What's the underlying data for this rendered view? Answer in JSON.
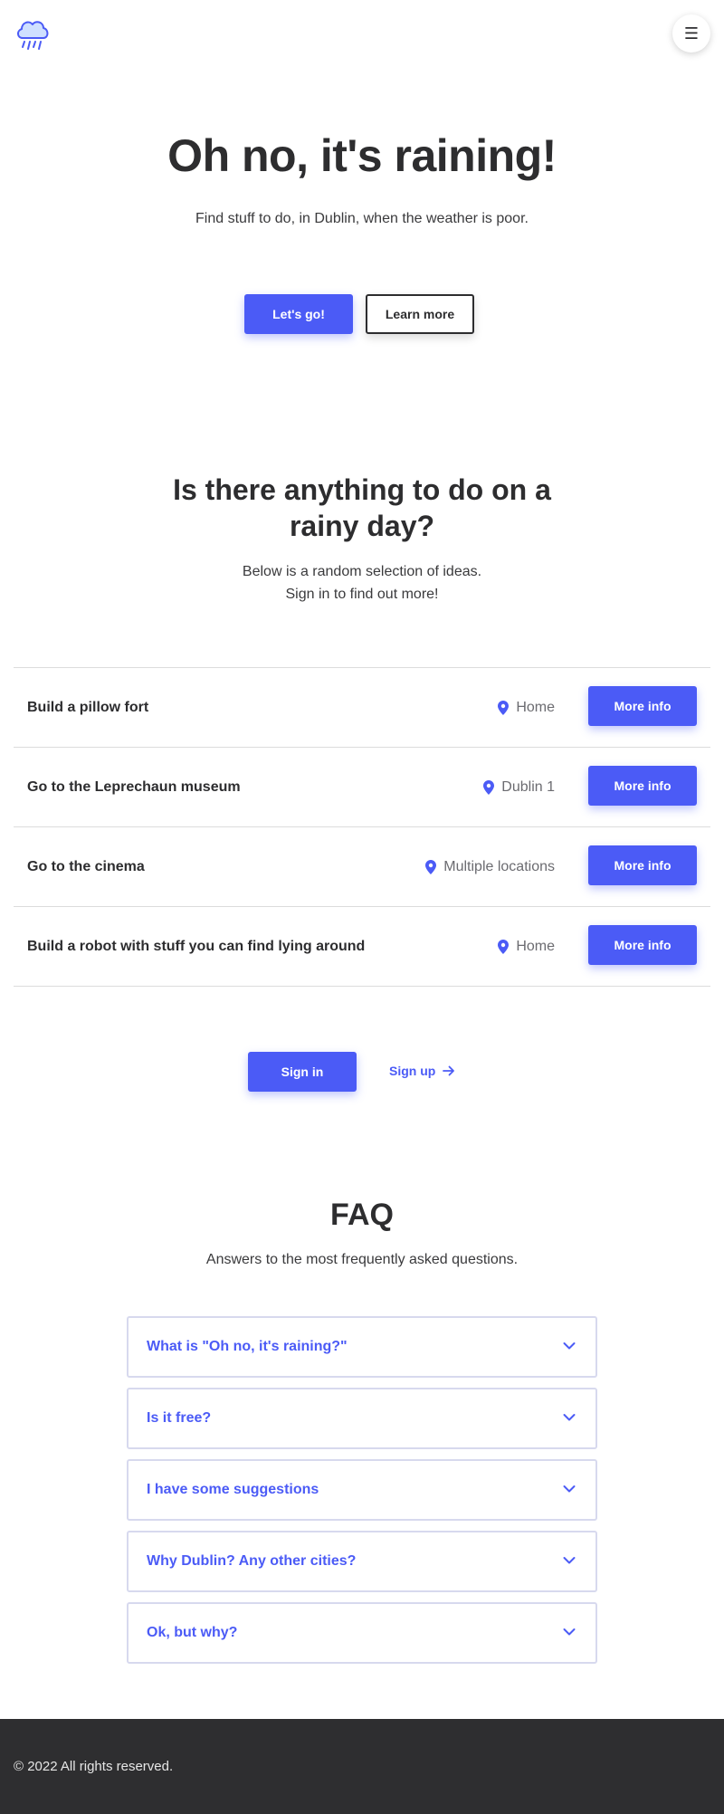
{
  "header": {
    "logo_icon": "rain-cloud-icon",
    "menu_icon": "hamburger-icon",
    "menu_glyph": "☰"
  },
  "hero": {
    "title": "Oh no, it's raining!",
    "subtitle": "Find stuff to do, in Dublin, when the weather is poor.",
    "primary_button": "Let's go!",
    "secondary_button": "Learn more"
  },
  "ideas": {
    "title": "Is there anything to do on a rainy day?",
    "subtitle_line1": "Below is a random selection of ideas.",
    "subtitle_line2": "Sign in to find out more!",
    "items": [
      {
        "title": "Build a pillow fort",
        "location": "Home",
        "button": "More info"
      },
      {
        "title": "Go to the Leprechaun museum",
        "location": "Dublin 1",
        "button": "More info"
      },
      {
        "title": "Go to the cinema",
        "location": "Multiple locations",
        "button": "More info"
      },
      {
        "title": "Build a robot with stuff you can find lying around",
        "location": "Home",
        "button": "More info"
      }
    ],
    "sign_in": "Sign in",
    "sign_up": "Sign up"
  },
  "faq": {
    "title": "FAQ",
    "subtitle": "Answers to the most frequently asked questions.",
    "items": [
      {
        "question": "What is \"Oh no, it's raining?\""
      },
      {
        "question": "Is it free?"
      },
      {
        "question": "I have some suggestions"
      },
      {
        "question": "Why Dublin? Any other cities?"
      },
      {
        "question": "Ok, but why?"
      }
    ]
  },
  "footer": {
    "text": "© 2022 All rights reserved."
  },
  "colors": {
    "accent": "#4b5bf6",
    "text": "#2d2d2f",
    "footer_bg": "#2e2e30",
    "border": "#dcdcdc"
  }
}
